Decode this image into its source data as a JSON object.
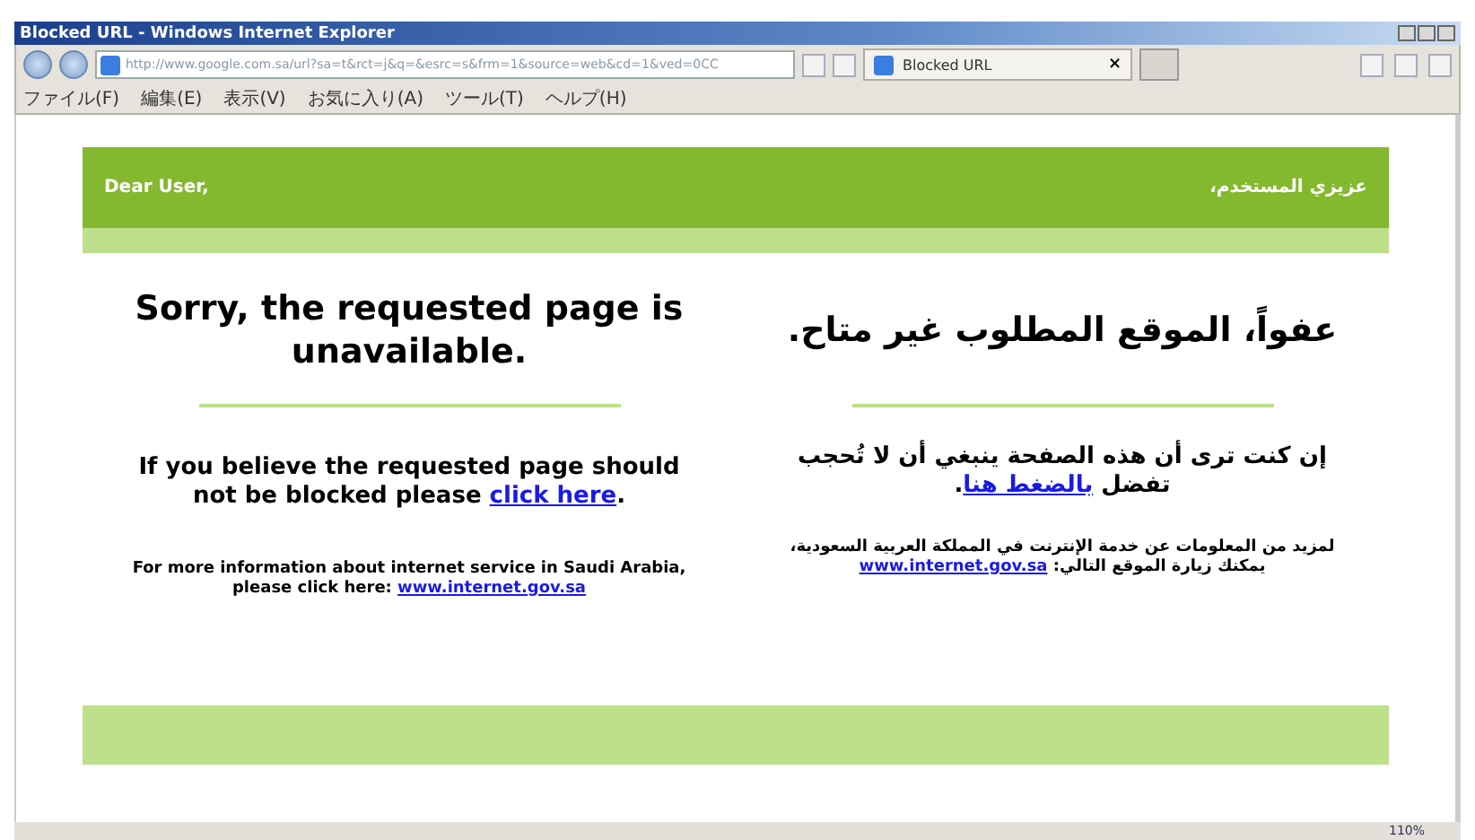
{
  "window": {
    "title": "Blocked URL - Windows Internet Explorer"
  },
  "address_bar": {
    "url": "http://www.google.com.sa/url?sa=t&rct=j&q=&esrc=s&frm=1&source=web&cd=1&ved=0CC"
  },
  "tabs": [
    {
      "label": "Blocked URL",
      "selected": true,
      "close": "×"
    }
  ],
  "menu": [
    "ファイル(F)",
    "編集(E)",
    "表示(V)",
    "お気に入り(A)",
    "ツール(T)",
    "ヘルプ(H)"
  ],
  "page": {
    "greeting_en": "Dear User,",
    "greeting_ar": "عزيزي المستخدم،",
    "heading_en": "Sorry, the requested page is unavailable.",
    "heading_ar": "عفواً، الموقع المطلوب غير متاح.",
    "unblock_en": {
      "text": "If you believe the requested page should not be blocked please ",
      "link": "click here",
      "after": "."
    },
    "unblock_ar": {
      "text": "إن كنت ترى أن هذه الصفحة ينبغي أن لا تُحجب تفضل ",
      "link": "بالضغط هنا",
      "after": "."
    },
    "info_en": {
      "text": "For more information about internet service in Saudi Arabia, please click here: ",
      "link": "www.internet.gov.sa"
    },
    "info_ar": {
      "text": "لمزيد من المعلومات عن خدمة الإنترنت في المملكة العربية السعودية، يمكنك زيارة الموقع التالي: ",
      "link": "www.internet.gov.sa"
    }
  },
  "status_bar": {
    "zoom": "110%"
  }
}
